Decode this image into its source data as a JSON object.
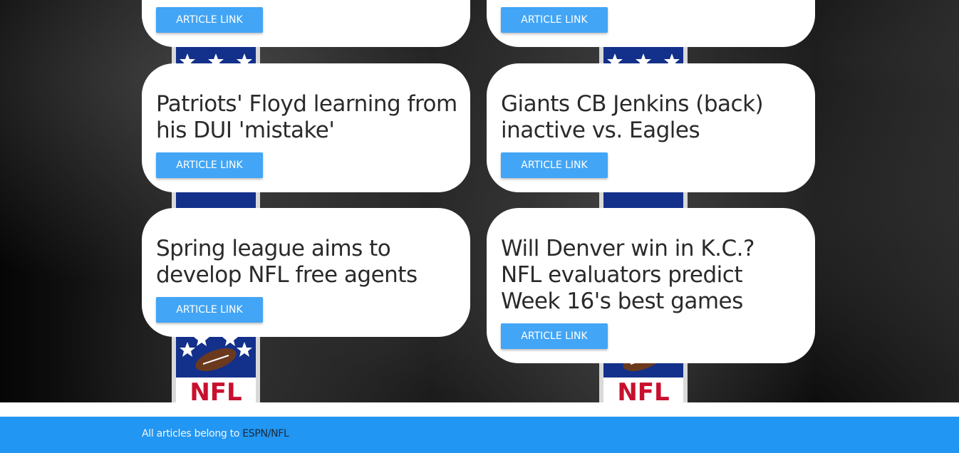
{
  "articles": [
    {
      "title": "",
      "button_label": "ARTICLE LINK"
    },
    {
      "title": "",
      "button_label": "ARTICLE LINK"
    },
    {
      "title": "Patriots' Floyd learning from his DUI 'mistake'",
      "button_label": "ARTICLE LINK"
    },
    {
      "title": "Giants CB Jenkins (back) inactive vs. Eagles",
      "button_label": "ARTICLE LINK"
    },
    {
      "title": "Spring league aims to develop NFL free agents",
      "button_label": "ARTICLE LINK"
    },
    {
      "title": "Will Denver win in K.C.? NFL evaluators predict Week 16's best games",
      "button_label": "ARTICLE LINK"
    }
  ],
  "footer": {
    "text": "All articles belong to ",
    "link_label": "ESPN/NFL"
  },
  "colors": {
    "button": "#42a5f5",
    "footer": "#2196f3"
  }
}
